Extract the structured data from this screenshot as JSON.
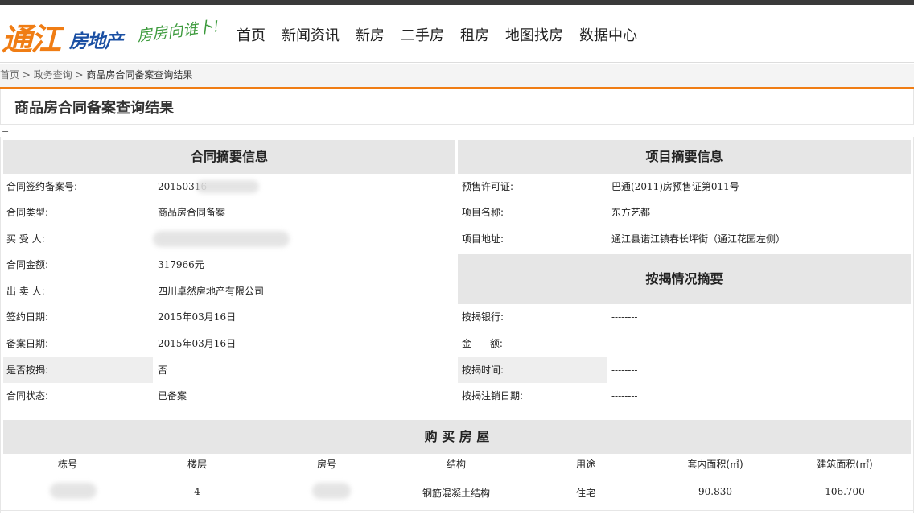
{
  "logo": {
    "main": "通江",
    "sub": "房地产",
    "slogan": "房房向谁卜!"
  },
  "nav": [
    "首页",
    "新闻资讯",
    "新房",
    "二手房",
    "租房",
    "地图找房",
    "数据中心"
  ],
  "breadcrumb": {
    "home": "首页",
    "sep1": " > ",
    "section": "政务查询",
    "sep2": " > ",
    "current": "商品房合同备案查询结果"
  },
  "page_title": "商品房合同备案查询结果",
  "eq_mark": "=",
  "contract": {
    "heading": "合同摘要信息",
    "rows": [
      {
        "label": "合同签约备案号:",
        "value": "20150316"
      },
      {
        "label": "合同类型:",
        "value": "商品房合同备案"
      },
      {
        "label": "买 受 人:",
        "value": ""
      },
      {
        "label": "合同金额:",
        "value": "317966元"
      },
      {
        "label": "出 卖 人:",
        "value": "四川卓然房地产有限公司"
      },
      {
        "label": "签约日期:",
        "value": "2015年03月16日"
      },
      {
        "label": "备案日期:",
        "value": "2015年03月16日"
      },
      {
        "label": "是否按揭:",
        "value": "否"
      },
      {
        "label": "合同状态:",
        "value": "已备案"
      }
    ]
  },
  "project": {
    "heading": "项目摘要信息",
    "rows": [
      {
        "label": "预售许可证:",
        "value": "巴通(2011)房预售证第011号"
      },
      {
        "label": "项目名称:",
        "value": "东方艺都"
      },
      {
        "label": "项目地址:",
        "value": "通江县诺江镇春长坪街（通江花园左侧）"
      }
    ]
  },
  "mortgage": {
    "heading": "按揭情况摘要",
    "rows": [
      {
        "label": "按揭银行:",
        "value": "--------"
      },
      {
        "label": "金      额:",
        "value": "--------"
      },
      {
        "label": "按揭时间:",
        "value": "--------"
      },
      {
        "label": "按揭注销日期:",
        "value": "--------"
      }
    ]
  },
  "house": {
    "heading": "购 买 房 屋",
    "columns": [
      "栋号",
      "楼层",
      "房号",
      "结构",
      "用途",
      "套内面积(㎡)",
      "建筑面积(㎡)"
    ],
    "row": [
      "",
      "4",
      "",
      "钢筋混凝土结构",
      "住宅",
      "90.830",
      "106.700"
    ]
  }
}
